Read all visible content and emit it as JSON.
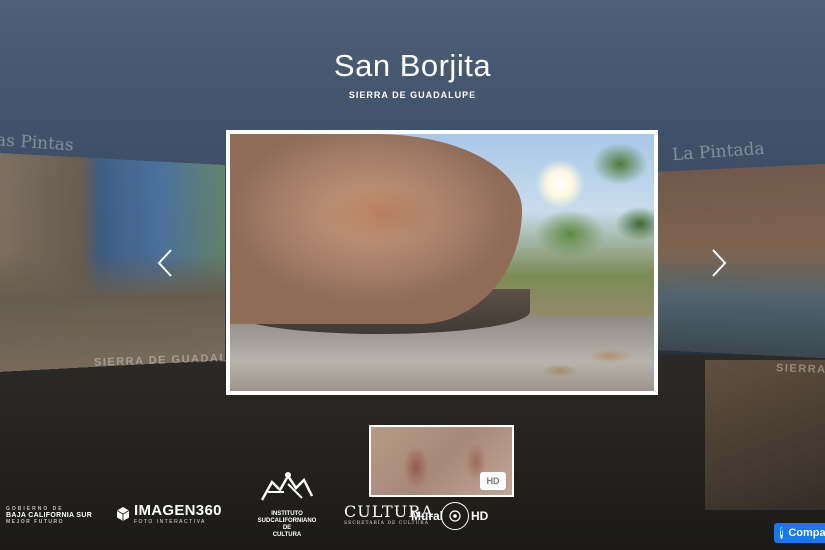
{
  "header": {
    "title": "San Borjita",
    "subtitle": "SIERRA DE GUADALUPE"
  },
  "carousel": {
    "prev_item": {
      "title": "as Pintas",
      "subtitle": "SIERRA DE GUADALUPE"
    },
    "next_item": {
      "title": "La Pintada",
      "subtitle": "SIERRA"
    },
    "prev_icon": "chevron-left-icon",
    "next_icon": "chevron-right-icon"
  },
  "thumbnail": {
    "badge": "HD"
  },
  "logos": {
    "bcs": {
      "line1": "GOBIERNO DE",
      "line2": "BAJA CALIFORNIA SUR",
      "line3": "MEJOR FUTURO"
    },
    "imagen360": {
      "name": "IMAGEN360",
      "tag": "FOTO INTERACTIVA"
    },
    "instituto": {
      "lines": [
        "INSTITUTO",
        "SUDCALIFORNIANO",
        "DE",
        "CULTURA"
      ]
    },
    "cultura": {
      "name": "CULTURA",
      "tag": "SECRETARÍA DE CULTURA"
    },
    "mural": {
      "name": "Mural",
      "suffix": "HD"
    }
  },
  "facebook": {
    "label": "Compartir",
    "color": "#1877f2"
  }
}
